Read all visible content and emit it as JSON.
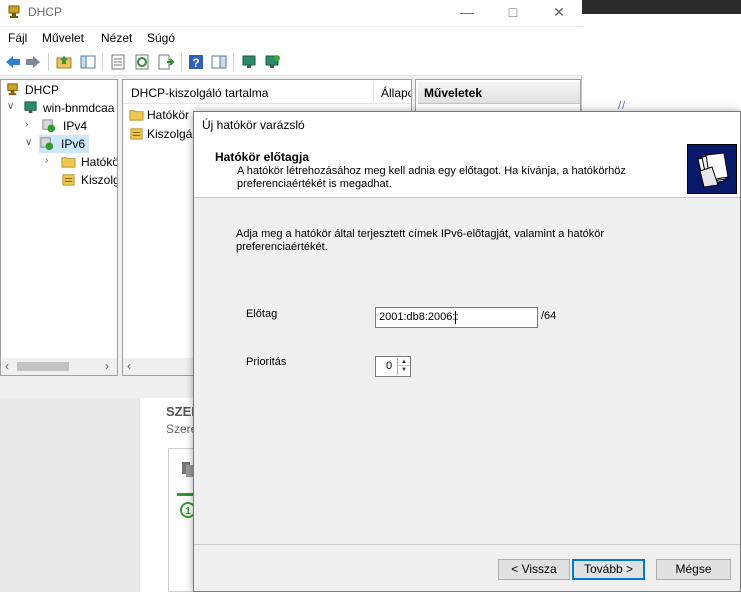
{
  "window": {
    "title": "DHCP"
  },
  "menu": [
    "Fájl",
    "Művelet",
    "Nézet",
    "Súgó"
  ],
  "tree": {
    "root": "DHCP",
    "server": "win-bnmdcaa",
    "ipv4": "IPv4",
    "ipv6": "IPv6",
    "scopes": "Hatókö",
    "server_options": "Kiszolg"
  },
  "content": {
    "col1": "DHCP-kiszolgáló tartalma",
    "col2": "Állapo",
    "rows": [
      "Hatókör",
      "Kiszolgál"
    ]
  },
  "actions": {
    "header": "Műveletek"
  },
  "lower": {
    "heading": "SZEF",
    "sub": "Szere"
  },
  "wizard": {
    "title": "Új hatókör varázsló",
    "header_title": "Hatókör előtagja",
    "header_sub": "A hatókör létrehozásához meg kell adnia egy előtagot. Ha kívánja, a hatókörhöz preferenciaértékét is megadhat.",
    "intro": "Adja meg a hatókör által terjesztett címek IPv6-előtagját, valamint a hatókör preferenciaértékét.",
    "prefix_label": "Előtag",
    "prefix_value": "2001:db8:2006::",
    "prefix_length": "/64",
    "priority_label": "Prioritás",
    "priority_value": "0",
    "back": "< Vissza",
    "next": "Tovább >",
    "cancel": "Mégse"
  },
  "colors": {
    "selection": "#cce8ff",
    "default_button_border": "#0078d7",
    "wizard_icon_bg": "#0a1a6a"
  }
}
